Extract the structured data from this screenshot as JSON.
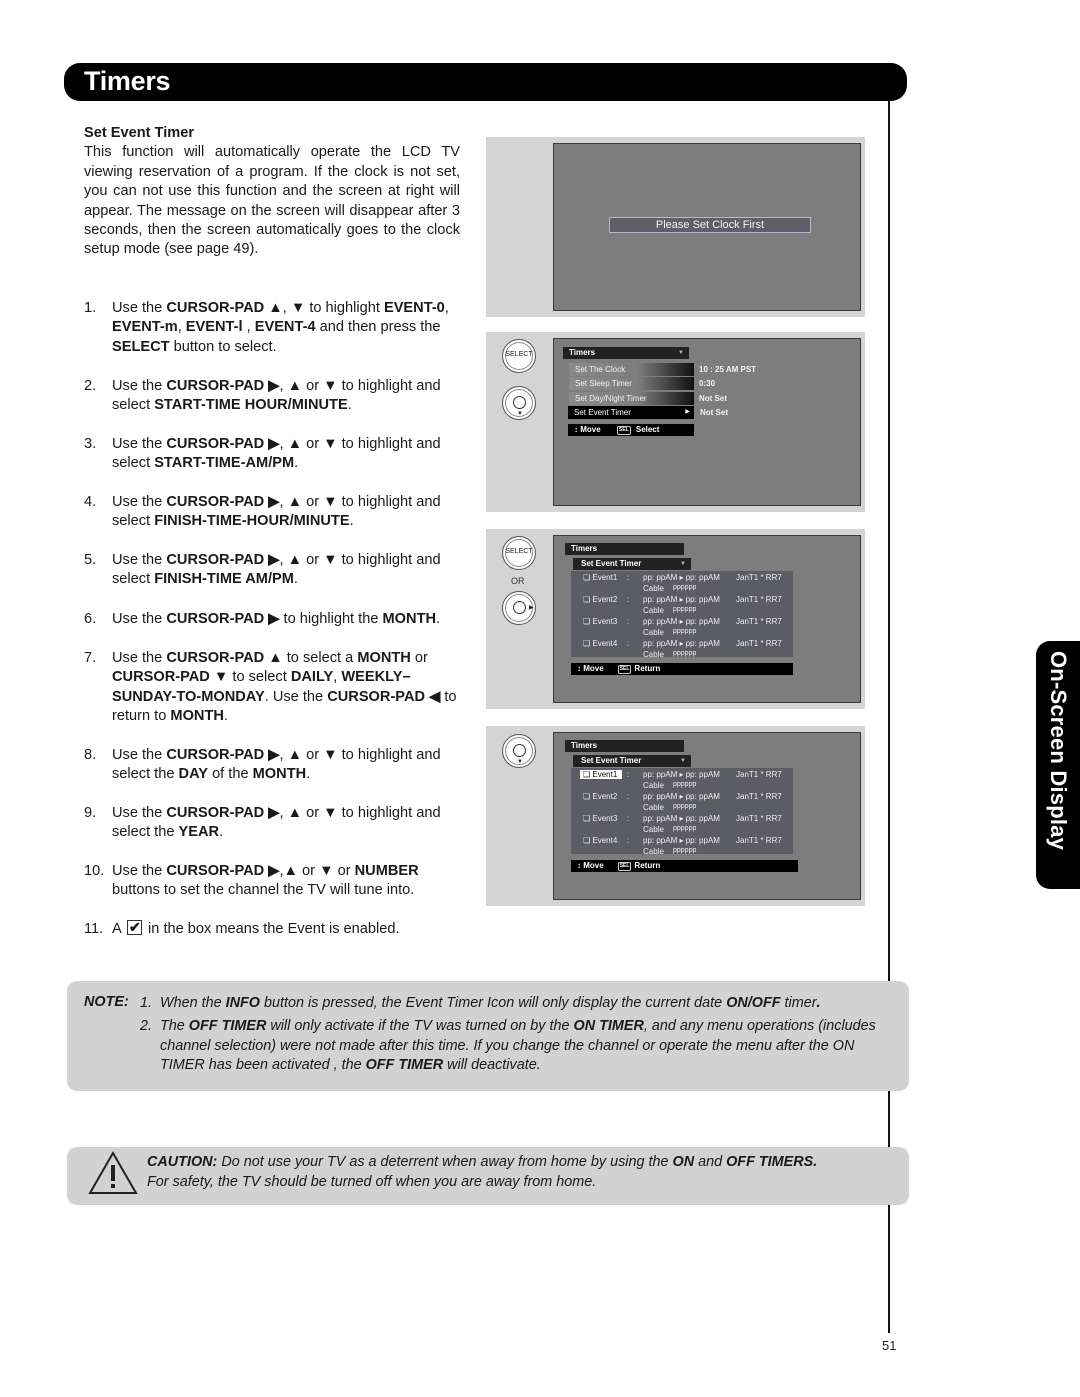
{
  "header": {
    "title": "Timers"
  },
  "side_tab": {
    "label": "On-Screen Display"
  },
  "section": {
    "title": "Set Event Timer",
    "intro": "This function will automatically operate the LCD TV viewing reservation of a program. If the clock is not set, you can not use this function and the screen at right will appear. The message on the screen will disappear after 3 seconds, then the screen automatically goes to the clock setup mode (see page 49)."
  },
  "steps": [
    {
      "num": "1.",
      "html": "Use the <b>CURSOR-PAD ▲</b>, <b>▼</b> to highlight <b>EVENT-0</b>, <b>EVENT-m</b>, <b>EVENT-l</b> , <b>EVENT-4</b> and then press the <b>SELECT</b> button to select."
    },
    {
      "num": "2.",
      "html": "Use the <b>CURSOR-PAD ▶</b>, <b>▲</b> or <b>▼</b> to highlight and select <b>START-TIME HOUR/MINUTE</b>."
    },
    {
      "num": "3.",
      "html": "Use the <b>CURSOR-PAD ▶</b>, <b>▲</b> or <b>▼</b> to highlight and select <b>START-TIME-AM/PM</b>."
    },
    {
      "num": "4.",
      "html": "Use the <b>CURSOR-PAD ▶</b>, <b>▲</b> or <b>▼</b> to highlight and select <b>FINISH-TIME-HOUR/MINUTE</b>."
    },
    {
      "num": "5.",
      "html": "Use the <b>CURSOR-PAD ▶</b>, <b>▲</b> or <b>▼</b> to highlight and select <b>FINISH-TIME AM/PM</b>."
    },
    {
      "num": "6.",
      "html": "Use the <b>CURSOR-PAD ▶</b> to highlight the <b>MONTH</b>."
    },
    {
      "num": "7.",
      "html": "Use the <b>CURSOR-PAD ▲</b> to select a <b>MONTH</b> or <b>CURSOR-PAD ▼</b> to select <b>DAILY</b>, <b>WEEKLY– SUNDAY-TO-MONDAY</b>. Use the <b>CURSOR-PAD ◀</b> to return to <b>MONTH</b>."
    },
    {
      "num": "8.",
      "html": "Use the <b>CURSOR-PAD ▶</b>, <b>▲</b> or <b>▼</b> to highlight and select the <b>DAY</b> of the <b>MONTH</b>."
    },
    {
      "num": "9.",
      "html": "Use the <b>CURSOR-PAD ▶</b>, <b>▲</b> or <b>▼</b> to highlight and select the <b>YEAR</b>."
    },
    {
      "num": "10.",
      "html": "Use the <b>CURSOR-PAD ▶</b>,<b>▲</b> or <b>▼</b> or <b>NUMBER</b> buttons to set the channel the TV will tune into."
    },
    {
      "num": "11.",
      "html": "A <span class=\"chk\"></span> in the box means the Event is enabled."
    }
  ],
  "screens": {
    "clock_message": "Please Set Clock First",
    "remote": {
      "select_label": "SELECT",
      "or_label": "OR"
    },
    "timers_menu": {
      "title": "Timers",
      "items": [
        {
          "label": "Set The Clock",
          "value": "10 : 25 AM PST",
          "selected": false
        },
        {
          "label": "Set Sleep Timer",
          "value": "0:30",
          "selected": false
        },
        {
          "label": "Set Day/Night Timer",
          "value": "Not Set",
          "selected": false
        },
        {
          "label": "Set Event Timer",
          "value": "Not Set",
          "selected": true
        }
      ],
      "footer_move": "Move",
      "footer_key": "SEL",
      "footer_action": "Select"
    },
    "event_menu": {
      "title": "Timers",
      "subtitle": "Set Event Timer",
      "events": [
        {
          "name": "Event1",
          "times": "pp: ppAM  ▸ pp: ppAM",
          "date": "JanT1 * RR7",
          "source": "Cable",
          "channel": "pppppp"
        },
        {
          "name": "Event2",
          "times": "pp: ppAM  ▸ pp: ppAM",
          "date": "JanT1 * RR7",
          "source": "Cable",
          "channel": "pppppp"
        },
        {
          "name": "Event3",
          "times": "pp: ppAM  ▸ pp: ppAM",
          "date": "JanT1 * RR7",
          "source": "Cable",
          "channel": "pppppp"
        },
        {
          "name": "Event4",
          "times": "pp: ppAM  ▸ pp: ppAM",
          "date": "JanT1 * RR7",
          "source": "Cable",
          "channel": "pppppp"
        }
      ],
      "footer_move": "Move",
      "footer_key": "SEL",
      "footer_action": "Return"
    }
  },
  "note": {
    "label": "NOTE:",
    "items": [
      {
        "num": "1.",
        "html": "When the <b>INFO</b> button is pressed, the Event Timer Icon will only display the current date <b>ON/OFF</b> timer<b>.</b>"
      },
      {
        "num": "2.",
        "html": "The <b>OFF TIMER</b> will only activate if the TV was turned on by the <b>ON TIMER</b>, and any menu operations (includes channel selection) were not made after this time. If you change the channel or operate the menu after the ON TIMER has been activated<b> </b>, the <b>OFF TIMER</b> will deactivate."
      }
    ]
  },
  "caution": {
    "html": "<b>CAUTION:</b> Do not use your TV as a deterrent when away from home by using the <b>ON</b> and <b>OFF TIMERS.</b><br>For safety, the TV should be turned off when you are away from home."
  },
  "page_number": "51"
}
